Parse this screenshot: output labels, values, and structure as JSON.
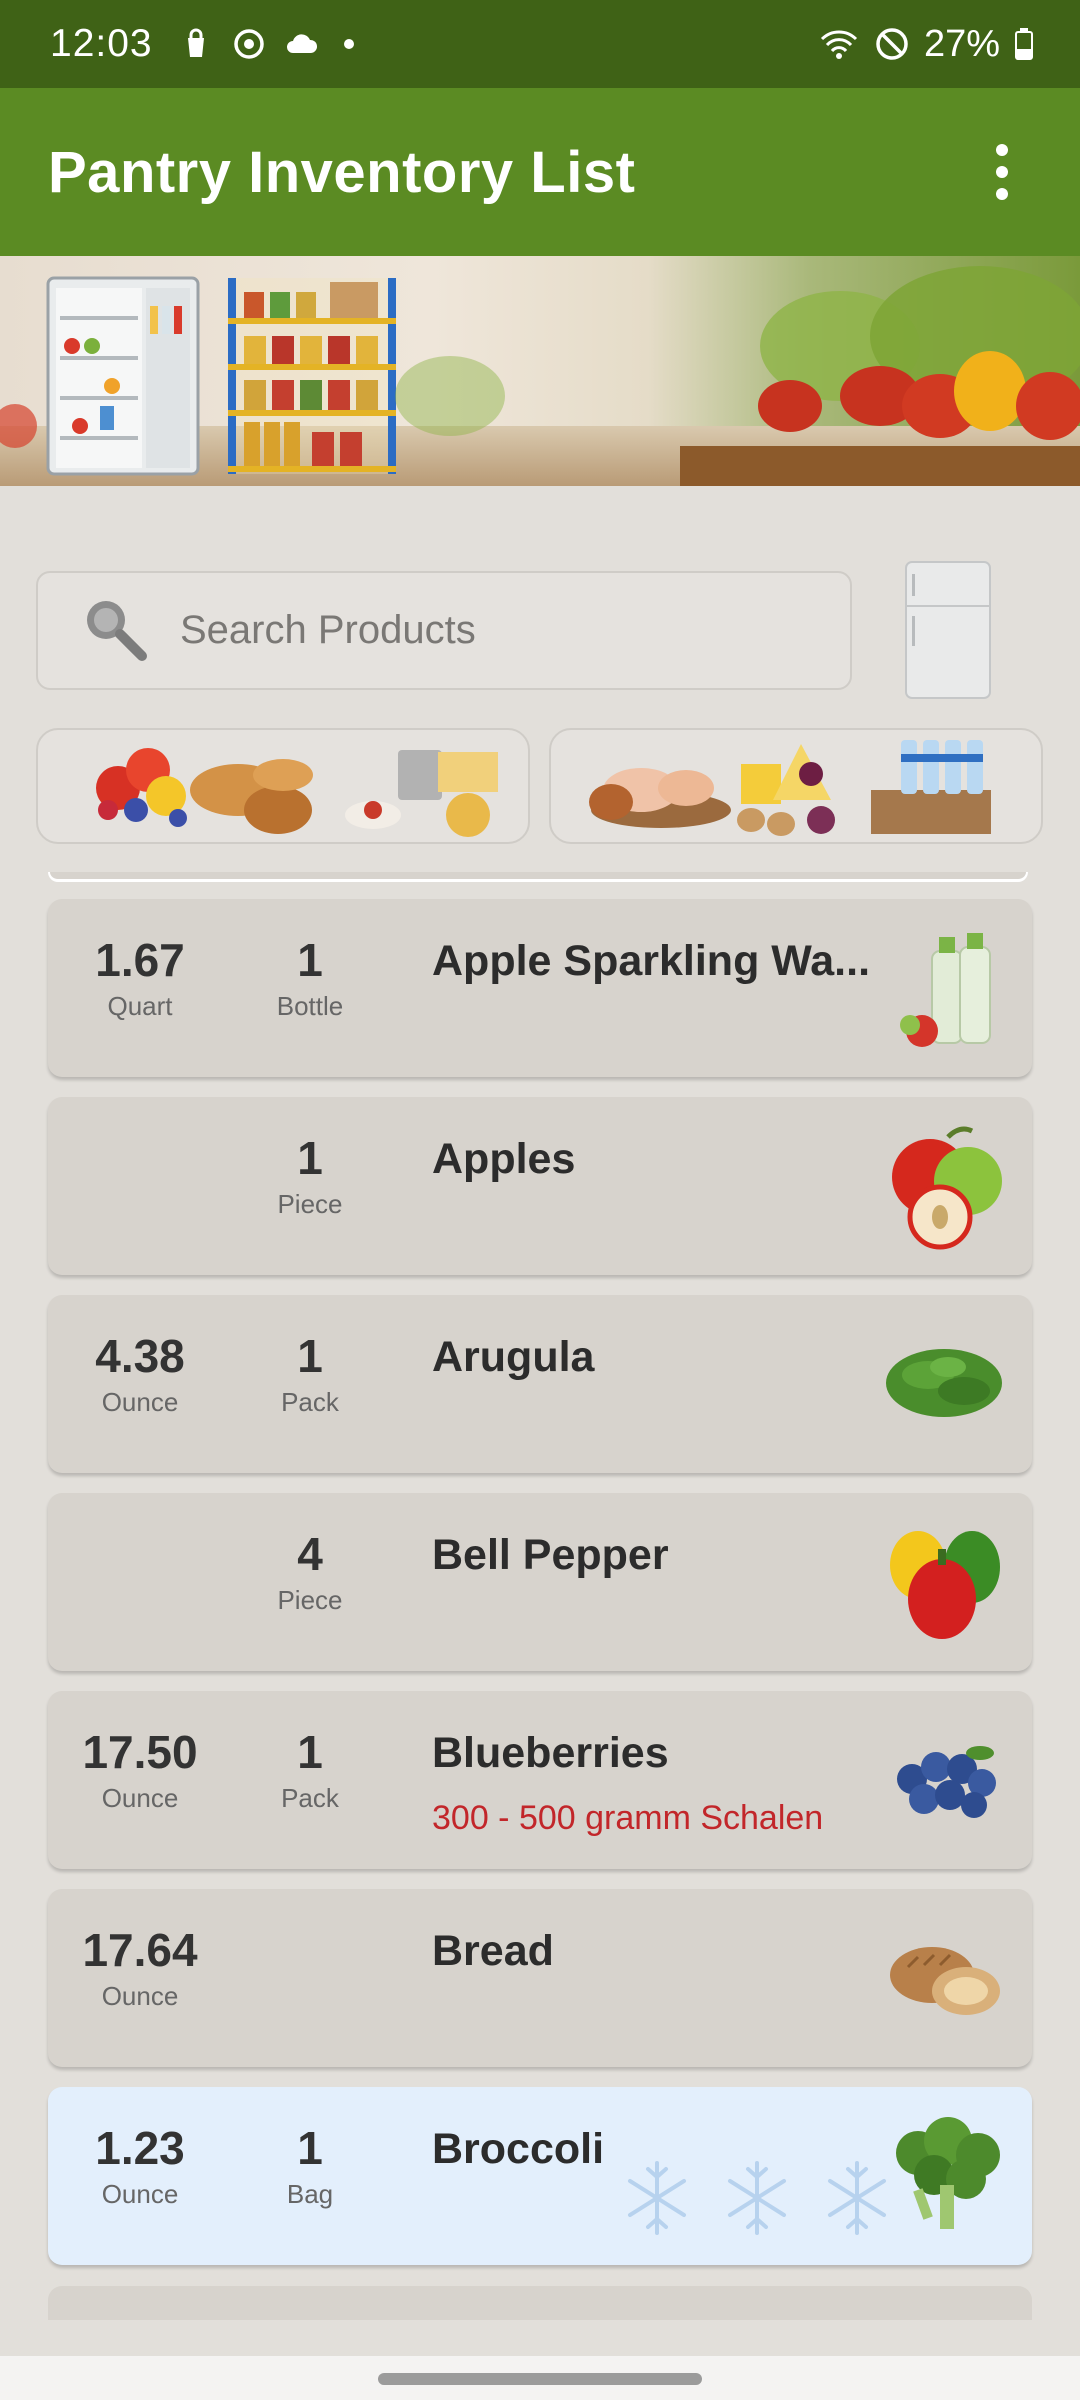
{
  "status_bar": {
    "time": "12:03",
    "battery": "27%",
    "icons": [
      "shopping-bag-icon",
      "focus-mode-icon",
      "cloud-icon",
      "dot-icon",
      "wifi-icon",
      "do-not-disturb-icon",
      "battery-icon"
    ]
  },
  "app_bar": {
    "title": "Pantry Inventory List",
    "menu_icon": "more-vert-icon"
  },
  "search": {
    "placeholder": "Search Products"
  },
  "categories": [
    {
      "name": "produce-bakery-pantry"
    },
    {
      "name": "meat-dairy-beverages"
    }
  ],
  "items": [
    {
      "amount": "1.67",
      "amount_unit": "Quart",
      "count": "1",
      "count_unit": "Bottle",
      "name": "Apple Sparkling Wa...",
      "note": "",
      "frozen": false
    },
    {
      "amount": "",
      "amount_unit": "",
      "count": "1",
      "count_unit": "Piece",
      "name": "Apples",
      "note": "",
      "frozen": false
    },
    {
      "amount": "4.38",
      "amount_unit": "Ounce",
      "count": "1",
      "count_unit": "Pack",
      "name": "Arugula",
      "note": "",
      "frozen": false
    },
    {
      "amount": "",
      "amount_unit": "",
      "count": "4",
      "count_unit": "Piece",
      "name": "Bell Pepper",
      "note": "",
      "frozen": false
    },
    {
      "amount": "17.50",
      "amount_unit": "Ounce",
      "count": "1",
      "count_unit": "Pack",
      "name": "Blueberries",
      "note": "300 - 500 gramm Schalen",
      "frozen": false
    },
    {
      "amount": "17.64",
      "amount_unit": "Ounce",
      "count": "",
      "count_unit": "",
      "name": "Bread",
      "note": "",
      "frozen": false
    },
    {
      "amount": "1.23",
      "amount_unit": "Ounce",
      "count": "1",
      "count_unit": "Bag",
      "name": "Broccoli",
      "note": "",
      "frozen": true
    }
  ],
  "colors": {
    "status_bar": "#3f6216",
    "app_bar": "#5b8b23",
    "background": "#e2dfda",
    "card": "#d7d3cd",
    "frozen_card": "#e3effc",
    "note_red": "#c2262a"
  }
}
